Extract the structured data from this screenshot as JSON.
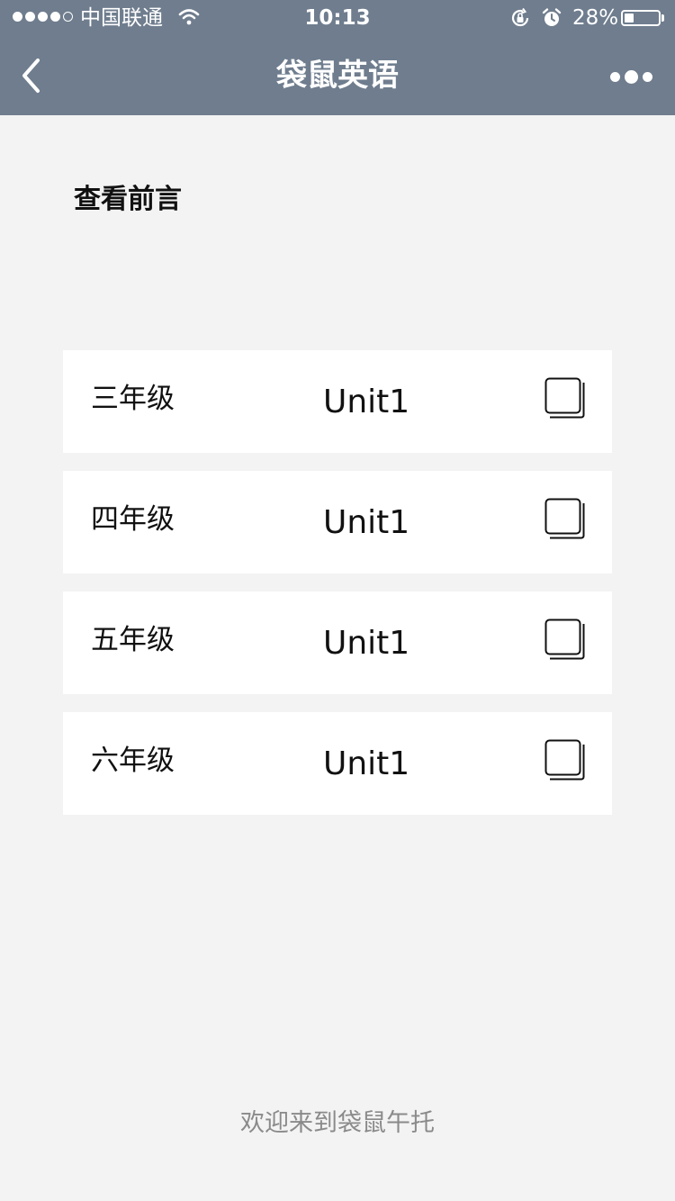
{
  "status_bar": {
    "carrier": "中国联通",
    "time": "10:13",
    "battery_percent": "28%",
    "battery_level": 0.28,
    "signal_bars_filled": 4,
    "signal_bars_total": 5,
    "icons": [
      "wifi-icon",
      "rotation-lock-icon",
      "alarm-icon",
      "battery-icon"
    ]
  },
  "nav": {
    "title": "袋鼠英语",
    "back_icon": "chevron-left-icon",
    "more_icon": "more-dots-icon"
  },
  "main": {
    "preface_label": "查看前言",
    "grades": [
      {
        "name": "三年级",
        "unit": "Unit1",
        "icon": "copy-icon"
      },
      {
        "name": "四年级",
        "unit": "Unit1",
        "icon": "copy-icon"
      },
      {
        "name": "五年级",
        "unit": "Unit1",
        "icon": "copy-icon"
      },
      {
        "name": "六年级",
        "unit": "Unit1",
        "icon": "copy-icon"
      }
    ]
  },
  "footer": {
    "text": "欢迎来到袋鼠午托"
  },
  "colors": {
    "header_bg": "#6f7d8e",
    "page_bg": "#f3f3f3",
    "card_bg": "#ffffff",
    "footer_text": "#8a8a8a"
  }
}
